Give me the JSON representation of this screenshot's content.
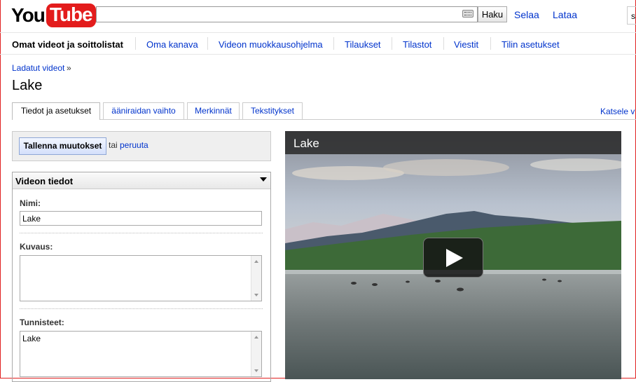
{
  "header": {
    "logo_you": "You",
    "logo_tube": "Tube",
    "search_button": "Haku",
    "links": [
      "Selaa",
      "Lataa"
    ],
    "signin_partial": "s"
  },
  "nav": {
    "items": [
      {
        "label": "Omat videot ja soittolistat",
        "active": true
      },
      {
        "label": "Oma kanava"
      },
      {
        "label": "Videon muokkausohjelma"
      },
      {
        "label": "Tilaukset"
      },
      {
        "label": "Tilastot"
      },
      {
        "label": "Viestit"
      },
      {
        "label": "Tilin asetukset"
      }
    ]
  },
  "breadcrumb": {
    "label": "Ladatut videot",
    "separator": "»"
  },
  "page_title": "Lake",
  "tabs": [
    {
      "label": "Tiedot ja asetukset",
      "active": true
    },
    {
      "label": "ääniraidan vaihto"
    },
    {
      "label": "Merkinnät"
    },
    {
      "label": "Tekstitykset"
    }
  ],
  "view_link": "Katsele v",
  "actions": {
    "save": "Tallenna muutokset",
    "or": "tai",
    "cancel": "peruuta"
  },
  "info_panel": {
    "title": "Videon tiedot",
    "name_label": "Nimi:",
    "name_value": "Lake",
    "description_label": "Kuvaus:",
    "description_value": "",
    "tags_label": "Tunnisteet:",
    "tags_value": "Lake"
  },
  "video": {
    "title": "Lake"
  },
  "colors": {
    "link": "#0033cc",
    "logo_red": "#e31c1c"
  }
}
